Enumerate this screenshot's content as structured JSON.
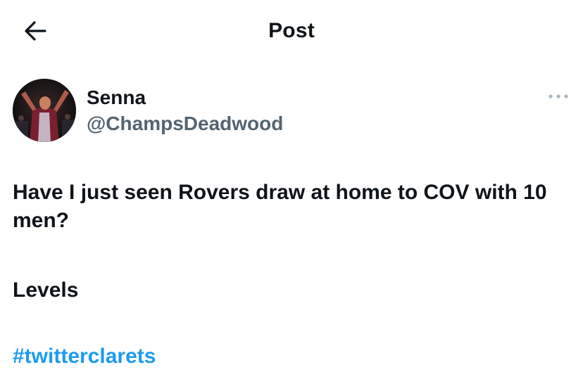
{
  "header": {
    "title": "Post",
    "back_icon": "arrow-left-icon"
  },
  "author": {
    "name": "Senna",
    "handle": "@ChampsDeadwood",
    "avatar_icon": "avatar-image",
    "more_icon": "more-horizontal-icon"
  },
  "post": {
    "line1": "Have I just seen Rovers draw at home to COV with 10 men?",
    "line2": "Levels",
    "hashtag": "#twitterclarets"
  },
  "colors": {
    "text": "#0f1419",
    "secondary": "#536471",
    "link": "#1d9bf0",
    "icon_muted": "#aab8c2"
  }
}
